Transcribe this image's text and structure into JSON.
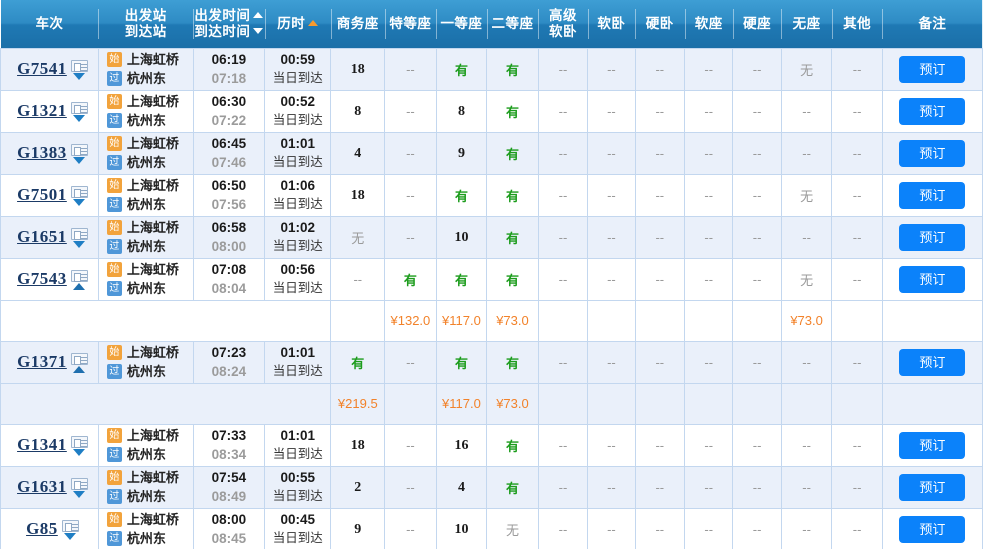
{
  "header": {
    "columns": [
      {
        "id": "train-no",
        "label": "车次",
        "lines": [
          "车次"
        ],
        "sort": null
      },
      {
        "id": "stations",
        "label": "出发站/到达站",
        "lines": [
          "出发站",
          "到达站"
        ],
        "sort": null
      },
      {
        "id": "times",
        "label": "出发时间/到达时间",
        "lines": [
          "出发时间",
          "到达时间"
        ],
        "sort": "both"
      },
      {
        "id": "duration",
        "label": "历时",
        "lines": [
          "历时"
        ],
        "sort": "up-active"
      },
      {
        "id": "business",
        "label": "商务座",
        "lines": [
          "商务座"
        ],
        "sort": null
      },
      {
        "id": "special",
        "label": "特等座",
        "lines": [
          "特等座"
        ],
        "sort": null
      },
      {
        "id": "first",
        "label": "一等座",
        "lines": [
          "一等座"
        ],
        "sort": null
      },
      {
        "id": "second",
        "label": "二等座",
        "lines": [
          "二等座"
        ],
        "sort": null
      },
      {
        "id": "gj-soft-sleeper",
        "label": "高级软卧",
        "lines": [
          "高级",
          "软卧"
        ],
        "sort": null
      },
      {
        "id": "soft-sleeper",
        "label": "软卧",
        "lines": [
          "软卧"
        ],
        "sort": null
      },
      {
        "id": "hard-sleeper",
        "label": "硬卧",
        "lines": [
          "硬卧"
        ],
        "sort": null
      },
      {
        "id": "soft-seat",
        "label": "软座",
        "lines": [
          "软座"
        ],
        "sort": null
      },
      {
        "id": "hard-seat",
        "label": "硬座",
        "lines": [
          "硬座"
        ],
        "sort": null
      },
      {
        "id": "no-seat",
        "label": "无座",
        "lines": [
          "无座"
        ],
        "sort": null
      },
      {
        "id": "other",
        "label": "其他",
        "lines": [
          "其他"
        ],
        "sort": null
      },
      {
        "id": "remark",
        "label": "备注",
        "lines": [
          "备注"
        ],
        "sort": null
      }
    ]
  },
  "labels": {
    "book_button": "预订",
    "arrive_same_day": "当日到达",
    "badge_start": "始",
    "badge_pass": "过",
    "dash": "--",
    "has_ticket": "有",
    "no_ticket": "无"
  },
  "rows": [
    {
      "train_no": "G7541",
      "expanded": false,
      "from_station": "上海虹桥",
      "to_station": "杭州东",
      "depart": "06:19",
      "arrive": "07:18",
      "duration": "00:59",
      "arrive_note": "当日到达",
      "seats": {
        "business": "18",
        "special": "--",
        "first": "有",
        "second": "有",
        "gj_soft_sleeper": "--",
        "soft_sleeper": "--",
        "hard_sleeper": "--",
        "soft_seat": "--",
        "hard_seat": "--",
        "no_seat": "无",
        "other": "--"
      },
      "remark": "预订"
    },
    {
      "train_no": "G1321",
      "expanded": false,
      "from_station": "上海虹桥",
      "to_station": "杭州东",
      "depart": "06:30",
      "arrive": "07:22",
      "duration": "00:52",
      "arrive_note": "当日到达",
      "seats": {
        "business": "8",
        "special": "--",
        "first": "8",
        "second": "有",
        "gj_soft_sleeper": "--",
        "soft_sleeper": "--",
        "hard_sleeper": "--",
        "soft_seat": "--",
        "hard_seat": "--",
        "no_seat": "--",
        "other": "--"
      },
      "remark": "预订"
    },
    {
      "train_no": "G1383",
      "expanded": false,
      "from_station": "上海虹桥",
      "to_station": "杭州东",
      "depart": "06:45",
      "arrive": "07:46",
      "duration": "01:01",
      "arrive_note": "当日到达",
      "seats": {
        "business": "4",
        "special": "--",
        "first": "9",
        "second": "有",
        "gj_soft_sleeper": "--",
        "soft_sleeper": "--",
        "hard_sleeper": "--",
        "soft_seat": "--",
        "hard_seat": "--",
        "no_seat": "--",
        "other": "--"
      },
      "remark": "预订"
    },
    {
      "train_no": "G7501",
      "expanded": false,
      "from_station": "上海虹桥",
      "to_station": "杭州东",
      "depart": "06:50",
      "arrive": "07:56",
      "duration": "01:06",
      "arrive_note": "当日到达",
      "seats": {
        "business": "18",
        "special": "--",
        "first": "有",
        "second": "有",
        "gj_soft_sleeper": "--",
        "soft_sleeper": "--",
        "hard_sleeper": "--",
        "soft_seat": "--",
        "hard_seat": "--",
        "no_seat": "无",
        "other": "--"
      },
      "remark": "预订"
    },
    {
      "train_no": "G1651",
      "expanded": false,
      "from_station": "上海虹桥",
      "to_station": "杭州东",
      "depart": "06:58",
      "arrive": "08:00",
      "duration": "01:02",
      "arrive_note": "当日到达",
      "seats": {
        "business": "无",
        "special": "--",
        "first": "10",
        "second": "有",
        "gj_soft_sleeper": "--",
        "soft_sleeper": "--",
        "hard_sleeper": "--",
        "soft_seat": "--",
        "hard_seat": "--",
        "no_seat": "--",
        "other": "--"
      },
      "remark": "预订"
    },
    {
      "train_no": "G7543",
      "expanded": true,
      "from_station": "上海虹桥",
      "to_station": "杭州东",
      "depart": "07:08",
      "arrive": "08:04",
      "duration": "00:56",
      "arrive_note": "当日到达",
      "seats": {
        "business": "--",
        "special": "有",
        "first": "有",
        "second": "有",
        "gj_soft_sleeper": "--",
        "soft_sleeper": "--",
        "hard_sleeper": "--",
        "soft_seat": "--",
        "hard_seat": "--",
        "no_seat": "无",
        "other": "--"
      },
      "remark": "预订",
      "prices": {
        "business": "",
        "special": "¥132.0",
        "first": "¥117.0",
        "second": "¥73.0",
        "gj_soft_sleeper": "",
        "soft_sleeper": "",
        "hard_sleeper": "",
        "soft_seat": "",
        "hard_seat": "",
        "no_seat": "¥73.0",
        "other": ""
      }
    },
    {
      "train_no": "G1371",
      "expanded": true,
      "from_station": "上海虹桥",
      "to_station": "杭州东",
      "depart": "07:23",
      "arrive": "08:24",
      "duration": "01:01",
      "arrive_note": "当日到达",
      "seats": {
        "business": "有",
        "special": "--",
        "first": "有",
        "second": "有",
        "gj_soft_sleeper": "--",
        "soft_sleeper": "--",
        "hard_sleeper": "--",
        "soft_seat": "--",
        "hard_seat": "--",
        "no_seat": "--",
        "other": "--"
      },
      "remark": "预订",
      "prices": {
        "business": "¥219.5",
        "special": "",
        "first": "¥117.0",
        "second": "¥73.0",
        "gj_soft_sleeper": "",
        "soft_sleeper": "",
        "hard_sleeper": "",
        "soft_seat": "",
        "hard_seat": "",
        "no_seat": "",
        "other": ""
      }
    },
    {
      "train_no": "G1341",
      "expanded": false,
      "from_station": "上海虹桥",
      "to_station": "杭州东",
      "depart": "07:33",
      "arrive": "08:34",
      "duration": "01:01",
      "arrive_note": "当日到达",
      "seats": {
        "business": "18",
        "special": "--",
        "first": "16",
        "second": "有",
        "gj_soft_sleeper": "--",
        "soft_sleeper": "--",
        "hard_sleeper": "--",
        "soft_seat": "--",
        "hard_seat": "--",
        "no_seat": "--",
        "other": "--"
      },
      "remark": "预订"
    },
    {
      "train_no": "G1631",
      "expanded": false,
      "from_station": "上海虹桥",
      "to_station": "杭州东",
      "depart": "07:54",
      "arrive": "08:49",
      "duration": "00:55",
      "arrive_note": "当日到达",
      "seats": {
        "business": "2",
        "special": "--",
        "first": "4",
        "second": "有",
        "gj_soft_sleeper": "--",
        "soft_sleeper": "--",
        "hard_sleeper": "--",
        "soft_seat": "--",
        "hard_seat": "--",
        "no_seat": "--",
        "other": "--"
      },
      "remark": "预订"
    },
    {
      "train_no": "G85",
      "expanded": false,
      "from_station": "上海虹桥",
      "to_station": "杭州东",
      "depart": "08:00",
      "arrive": "08:45",
      "duration": "00:45",
      "arrive_note": "当日到达",
      "seats": {
        "business": "9",
        "special": "--",
        "first": "10",
        "second": "无",
        "gj_soft_sleeper": "--",
        "soft_sleeper": "--",
        "hard_sleeper": "--",
        "soft_seat": "--",
        "hard_seat": "--",
        "no_seat": "--",
        "other": "--"
      },
      "remark": "预订"
    }
  ],
  "colors": {
    "header_blue": "#2e8bc4",
    "button_blue": "#0b82fa",
    "row_alt": "#eaf0fa",
    "grid_line": "#c3d7ef",
    "price_orange": "#f2822a",
    "available_green": "#1c9c1c",
    "unavailable_gray": "#9a9a9a"
  }
}
